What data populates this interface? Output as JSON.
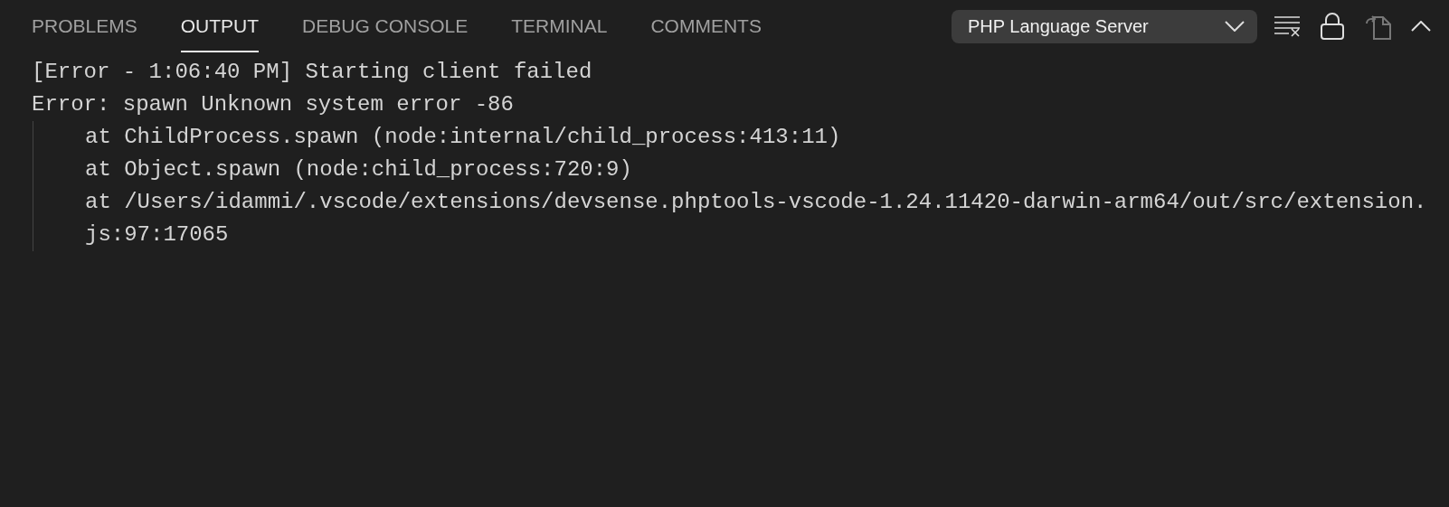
{
  "tabs": [
    {
      "label": "PROBLEMS",
      "selected": false
    },
    {
      "label": "OUTPUT",
      "selected": true
    },
    {
      "label": "DEBUG CONSOLE",
      "selected": false
    },
    {
      "label": "TERMINAL",
      "selected": false
    },
    {
      "label": "COMMENTS",
      "selected": false
    }
  ],
  "channel_dropdown": {
    "value": "PHP Language Server"
  },
  "output_lines": [
    {
      "text": "[Error - 1:06:40 PM] Starting client failed",
      "indented": false
    },
    {
      "text": "Error: spawn Unknown system error -86",
      "indented": false
    },
    {
      "text": "at ChildProcess.spawn (node:internal/child_process:413:11)",
      "indented": true
    },
    {
      "text": "at Object.spawn (node:child_process:720:9)",
      "indented": true
    },
    {
      "text": "at /Users/idammi/.vscode/extensions/devsense.phptools-vscode-1.24.11420-darwin-arm64/out/src/extension.",
      "indented": true
    },
    {
      "text": "js:97:17065",
      "indented": true
    }
  ]
}
